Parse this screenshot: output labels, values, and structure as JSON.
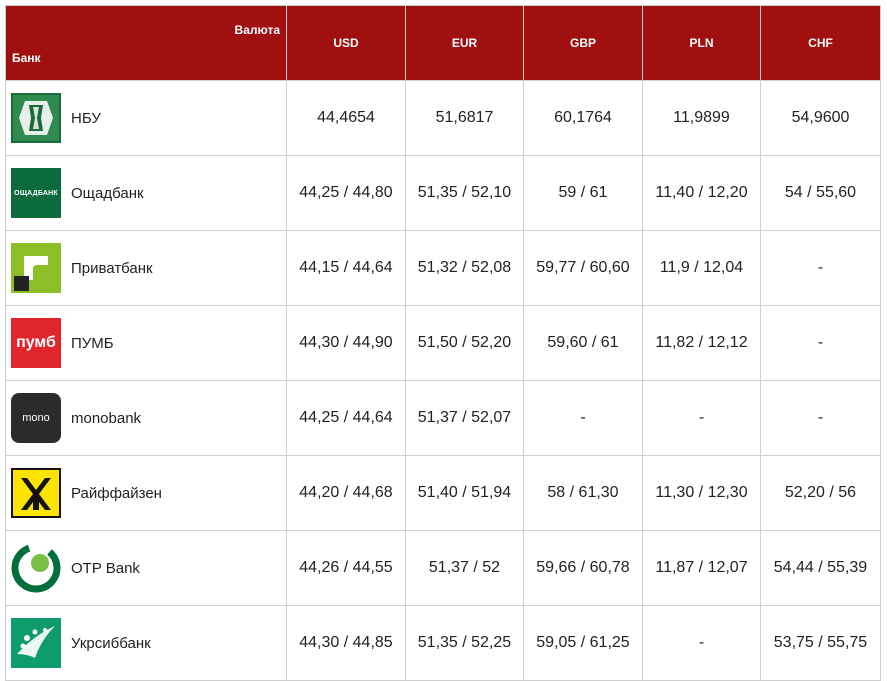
{
  "header": {
    "valuta_label": "Валюта",
    "bank_label": "Банк",
    "currencies": [
      "USD",
      "EUR",
      "GBP",
      "PLN",
      "CHF"
    ]
  },
  "banks": [
    {
      "name": "НБУ",
      "logo": "nbu-logo-icon",
      "logo_color": "#1a6b3a",
      "rates": [
        "44,4654",
        "51,6817",
        "60,1764",
        "11,9899",
        "54,9600"
      ]
    },
    {
      "name": "Ощадбанк",
      "logo": "oschadbank-logo-icon",
      "logo_color": "#0b6b3a",
      "logo_text": "ОЩАДБАНК",
      "rates": [
        "44,25 / 44,80",
        "51,35 / 52,10",
        "59 / 61",
        "11,40 / 12,20",
        "54 / 55,60"
      ]
    },
    {
      "name": "Приватбанк",
      "logo": "privatbank-logo-icon",
      "logo_color": "#8cbf26",
      "rates": [
        "44,15 / 44,64",
        "51,32 / 52,08",
        "59,77 / 60,60",
        "11,9 / 12,04",
        "-"
      ]
    },
    {
      "name": "ПУМБ",
      "logo": "pumb-logo-icon",
      "logo_color": "#e0262b",
      "logo_text": "пумб",
      "rates": [
        "44,30 / 44,90",
        "51,50 / 52,20",
        "59,60 / 61",
        "11,82 / 12,12",
        "-"
      ]
    },
    {
      "name": "monobank",
      "logo": "monobank-logo-icon",
      "logo_color": "#2b2b2b",
      "logo_text": "mono",
      "rates": [
        "44,25 / 44,64",
        "51,37 / 52,07",
        "-",
        "-",
        "-"
      ]
    },
    {
      "name": "Райффайзен",
      "logo": "raiffeisen-logo-icon",
      "logo_color": "#fce300",
      "rates": [
        "44,20 / 44,68",
        "51,40 / 51,94",
        "58 / 61,30",
        "11,30 / 12,30",
        "52,20 / 56"
      ]
    },
    {
      "name": "OTP Bank",
      "logo": "otp-bank-logo-icon",
      "logo_color": "#006f3c",
      "rates": [
        "44,26 / 44,55",
        "51,37 / 52",
        "59,66 / 60,78",
        "11,87 / 12,07",
        "54,44 / 55,39"
      ]
    },
    {
      "name": "Укрсиббанк",
      "logo": "ukrsibbank-logo-icon",
      "logo_color": "#0e9b6d",
      "rates": [
        "44,30 / 44,85",
        "51,35 / 52,25",
        "59,05 / 61,25",
        "-",
        "53,75 / 55,75"
      ]
    }
  ]
}
